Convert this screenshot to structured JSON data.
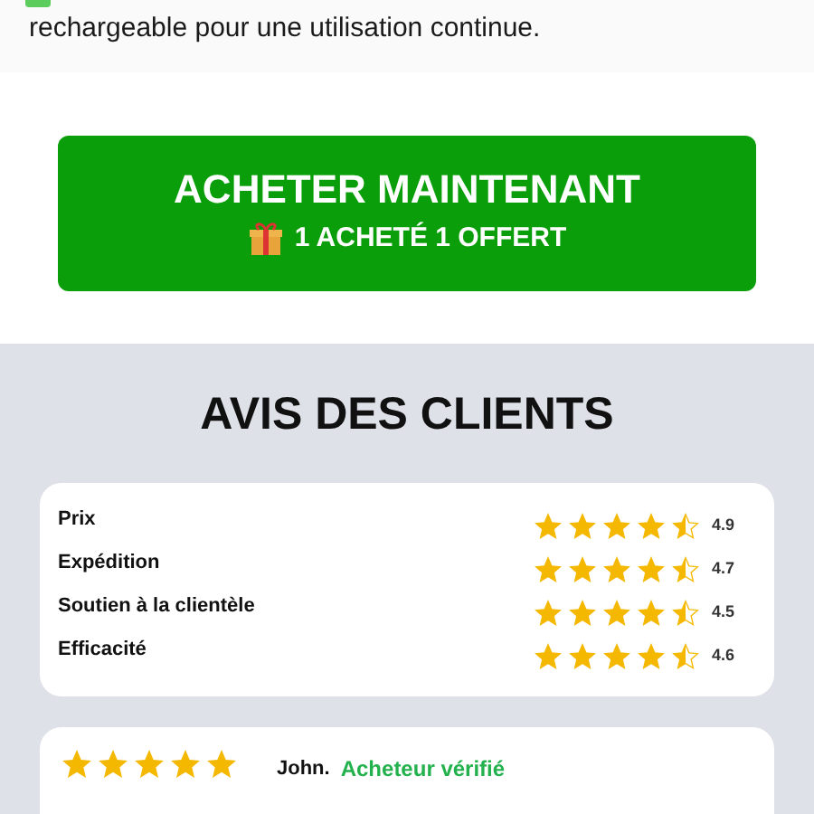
{
  "intro": {
    "text": "rechargeable pour une utilisation continue."
  },
  "buy_button": {
    "label": "ACHETER MAINTENANT",
    "offer": "1 ACHETÉ 1 OFFERT"
  },
  "reviews": {
    "title": "AVIS DES CLIENTS",
    "ratings": [
      {
        "label": "Prix",
        "stars": 4.5,
        "score": "4.9"
      },
      {
        "label": "Expédition",
        "stars": 4.5,
        "score": "4.7"
      },
      {
        "label": "Soutien à la clientèle",
        "stars": 4.5,
        "score": "4.5"
      },
      {
        "label": "Efficacité",
        "stars": 4.5,
        "score": "4.6"
      }
    ],
    "review": {
      "stars": 5,
      "author": "John.",
      "badge": "Acheteur vérifié"
    }
  }
}
